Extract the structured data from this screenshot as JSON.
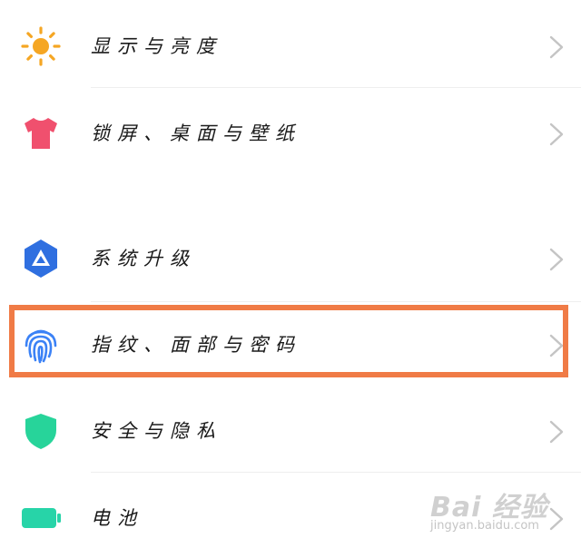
{
  "settings": {
    "items": [
      {
        "label": "显示与亮度",
        "icon": "sun-icon",
        "color": "#f5a623"
      },
      {
        "label": "锁屏、桌面与壁纸",
        "icon": "tshirt-icon",
        "color": "#f0506e"
      },
      {
        "label": "系统升级",
        "icon": "system-update-icon",
        "color": "#2f6fe0"
      },
      {
        "label": "指纹、面部与密码",
        "icon": "fingerprint-icon",
        "color": "#3b82f6"
      },
      {
        "label": "安全与隐私",
        "icon": "shield-icon",
        "color": "#27d49a"
      },
      {
        "label": "电池",
        "icon": "battery-icon",
        "color": "#27d4a8"
      }
    ],
    "chevron_icon": "chevron-right-icon",
    "highlight_color": "#f07b46"
  },
  "watermark": {
    "main": "Bai 经验",
    "sub": "jingyan.baidu.com"
  }
}
